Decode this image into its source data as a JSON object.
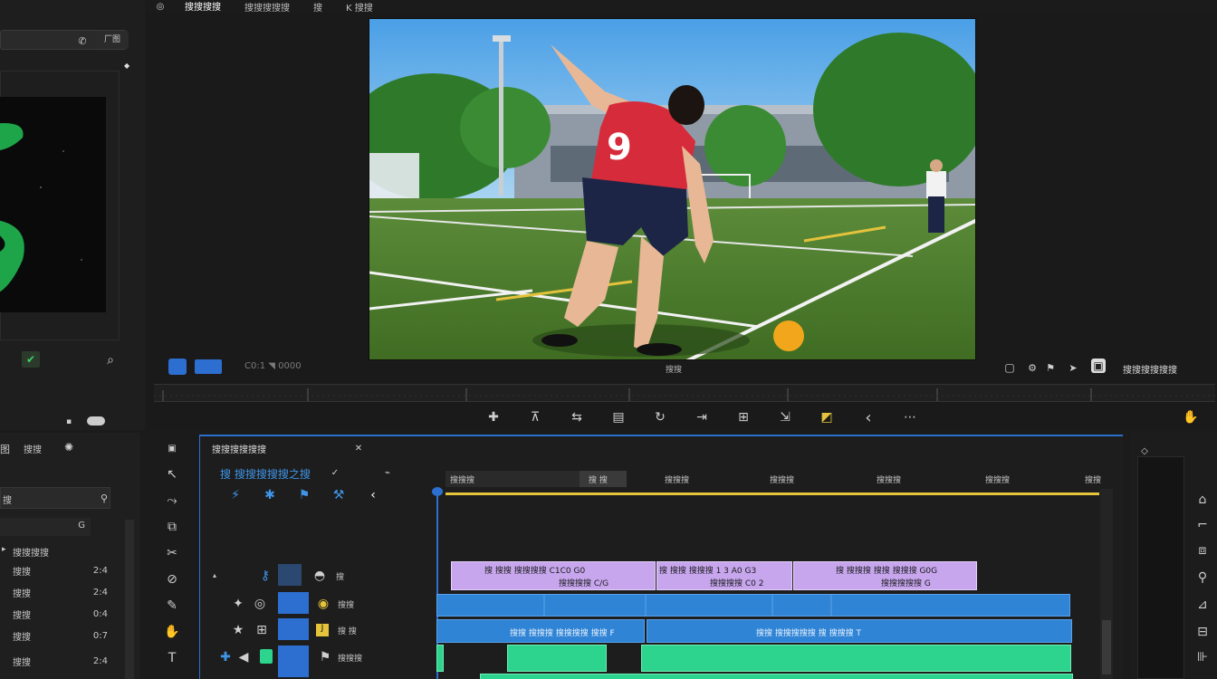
{
  "program": {
    "tabs": [
      "搜搜搜搜",
      "搜搜搜搜搜",
      "搜",
      "K 搜搜"
    ],
    "timecode_left": "C0:1 ◥ 0000",
    "center_label": "搜搜",
    "fit_label": "搜搜搜搜搜搜"
  },
  "source": {
    "search_btn": "厂图"
  },
  "project": {
    "tab_a": "图",
    "tab_b": "搜搜",
    "folder": "搜搜搜搜",
    "search_label": "搜",
    "count": "G",
    "items": [
      {
        "name": "搜搜",
        "dur": "2:4"
      },
      {
        "name": "搜搜",
        "dur": "2:4"
      },
      {
        "name": "搜搜",
        "dur": "0:4"
      },
      {
        "name": "搜搜",
        "dur": "0:7"
      },
      {
        "name": "搜搜",
        "dur": "2:4"
      }
    ]
  },
  "timeline": {
    "tab_label": "搜搜搜搜搜搜",
    "sequence_name": "搜 搜搜搜搜搜之搜",
    "ruler_labels": [
      "搜搜搜",
      "搜搜搜",
      "搜搜搜",
      "搜搜搜",
      "搜搜搜",
      "搜搜"
    ],
    "ruler_inout": "搜 搜",
    "tracks": [
      {
        "label": "搜"
      },
      {
        "label": "搜搜"
      },
      {
        "label": "搜 搜"
      },
      {
        "label": "搜搜搜"
      }
    ],
    "v_clips": [
      {
        "top": "搜 搜搜 搜搜搜搜 C1C0 G0",
        "bottom": "搜搜搜搜 C/G"
      },
      {
        "top": "搜 搜搜 搜搜搜 1 3 A0 G3",
        "bottom": "搜搜搜搜 C0 2"
      },
      {
        "top": "搜 搜搜搜 搜搜 搜搜搜 G0G",
        "bottom": "搜搜搜搜搜 G"
      }
    ],
    "b_clip_text": "搜搜 搜搜搜 搜搜搜搜 搜搜 F",
    "b_clip_text2": "搜搜 搜搜搜搜搜 搜 搜搜搜 T"
  },
  "colors": {
    "accent": "#2d6fd1",
    "clip_purple": "#c7a6ee",
    "clip_blue": "#2f84d6",
    "clip_green": "#2dd48d",
    "playhead_yellow": "#e5c33b"
  }
}
